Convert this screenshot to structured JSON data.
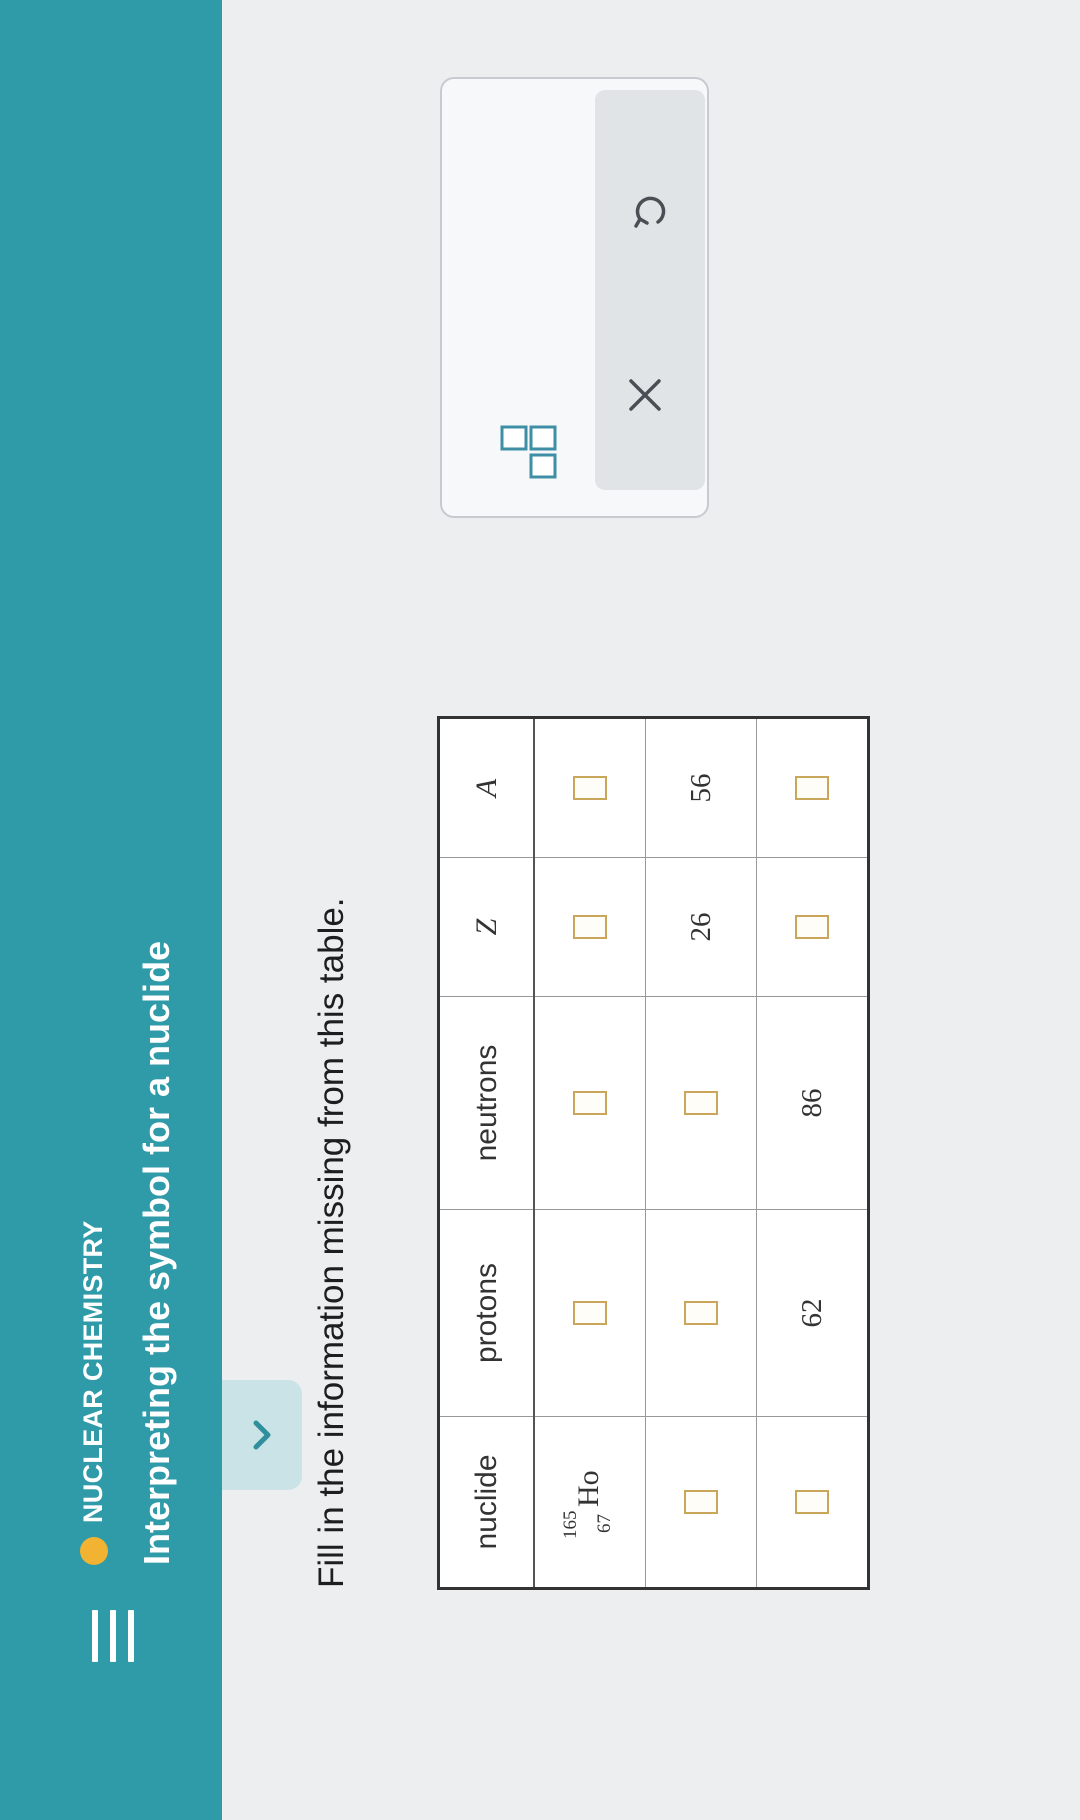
{
  "header": {
    "topic": "NUCLEAR CHEMISTRY",
    "title": "Interpreting the symbol for a nuclide",
    "topic_dot_color": "#f1b331",
    "bar_color": "#2f9aa8"
  },
  "prompt": "Fill in the information missing from this table.",
  "table": {
    "headers": [
      "nuclide",
      "protons",
      "neutrons",
      "Z",
      "A"
    ],
    "row1": {
      "nuclide": {
        "mass": "165",
        "atomic": "67",
        "symbol": "Ho"
      }
    },
    "row2": {
      "Z": "26",
      "A": "56"
    },
    "row3": {
      "protons": "62",
      "neutrons": "86"
    }
  },
  "toolbox": {
    "icons": [
      "fraction-template-icon",
      "clear-icon",
      "undo-icon"
    ]
  }
}
